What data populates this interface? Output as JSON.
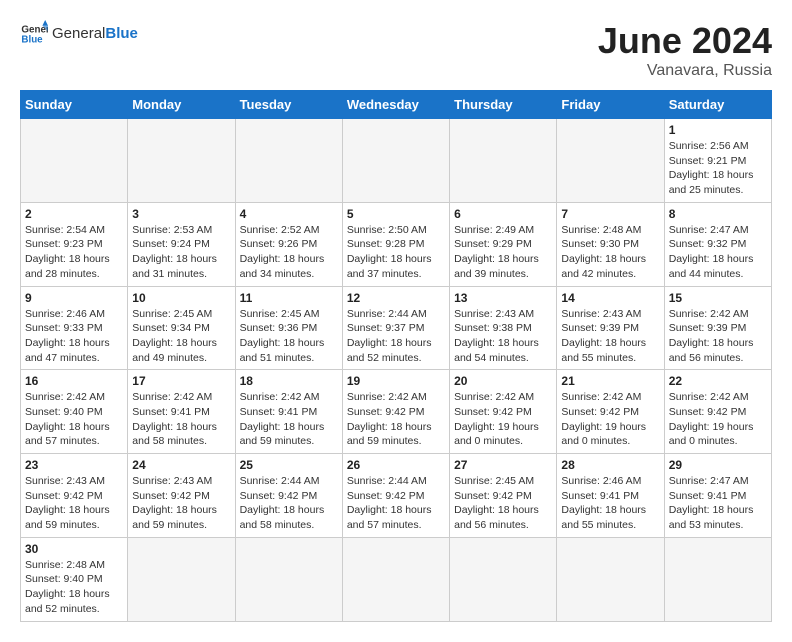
{
  "header": {
    "logo_general": "General",
    "logo_blue": "Blue",
    "month_year": "June 2024",
    "location": "Vanavara, Russia"
  },
  "days_of_week": [
    "Sunday",
    "Monday",
    "Tuesday",
    "Wednesday",
    "Thursday",
    "Friday",
    "Saturday"
  ],
  "weeks": [
    [
      {
        "day": "",
        "info": ""
      },
      {
        "day": "",
        "info": ""
      },
      {
        "day": "",
        "info": ""
      },
      {
        "day": "",
        "info": ""
      },
      {
        "day": "",
        "info": ""
      },
      {
        "day": "",
        "info": ""
      },
      {
        "day": "1",
        "info": "Sunrise: 2:56 AM\nSunset: 9:21 PM\nDaylight: 18 hours\nand 25 minutes."
      }
    ],
    [
      {
        "day": "2",
        "info": "Sunrise: 2:54 AM\nSunset: 9:23 PM\nDaylight: 18 hours\nand 28 minutes."
      },
      {
        "day": "3",
        "info": "Sunrise: 2:53 AM\nSunset: 9:24 PM\nDaylight: 18 hours\nand 31 minutes."
      },
      {
        "day": "4",
        "info": "Sunrise: 2:52 AM\nSunset: 9:26 PM\nDaylight: 18 hours\nand 34 minutes."
      },
      {
        "day": "5",
        "info": "Sunrise: 2:50 AM\nSunset: 9:28 PM\nDaylight: 18 hours\nand 37 minutes."
      },
      {
        "day": "6",
        "info": "Sunrise: 2:49 AM\nSunset: 9:29 PM\nDaylight: 18 hours\nand 39 minutes."
      },
      {
        "day": "7",
        "info": "Sunrise: 2:48 AM\nSunset: 9:30 PM\nDaylight: 18 hours\nand 42 minutes."
      },
      {
        "day": "8",
        "info": "Sunrise: 2:47 AM\nSunset: 9:32 PM\nDaylight: 18 hours\nand 44 minutes."
      }
    ],
    [
      {
        "day": "9",
        "info": "Sunrise: 2:46 AM\nSunset: 9:33 PM\nDaylight: 18 hours\nand 47 minutes."
      },
      {
        "day": "10",
        "info": "Sunrise: 2:45 AM\nSunset: 9:34 PM\nDaylight: 18 hours\nand 49 minutes."
      },
      {
        "day": "11",
        "info": "Sunrise: 2:45 AM\nSunset: 9:36 PM\nDaylight: 18 hours\nand 51 minutes."
      },
      {
        "day": "12",
        "info": "Sunrise: 2:44 AM\nSunset: 9:37 PM\nDaylight: 18 hours\nand 52 minutes."
      },
      {
        "day": "13",
        "info": "Sunrise: 2:43 AM\nSunset: 9:38 PM\nDaylight: 18 hours\nand 54 minutes."
      },
      {
        "day": "14",
        "info": "Sunrise: 2:43 AM\nSunset: 9:39 PM\nDaylight: 18 hours\nand 55 minutes."
      },
      {
        "day": "15",
        "info": "Sunrise: 2:42 AM\nSunset: 9:39 PM\nDaylight: 18 hours\nand 56 minutes."
      }
    ],
    [
      {
        "day": "16",
        "info": "Sunrise: 2:42 AM\nSunset: 9:40 PM\nDaylight: 18 hours\nand 57 minutes."
      },
      {
        "day": "17",
        "info": "Sunrise: 2:42 AM\nSunset: 9:41 PM\nDaylight: 18 hours\nand 58 minutes."
      },
      {
        "day": "18",
        "info": "Sunrise: 2:42 AM\nSunset: 9:41 PM\nDaylight: 18 hours\nand 59 minutes."
      },
      {
        "day": "19",
        "info": "Sunrise: 2:42 AM\nSunset: 9:42 PM\nDaylight: 18 hours\nand 59 minutes."
      },
      {
        "day": "20",
        "info": "Sunrise: 2:42 AM\nSunset: 9:42 PM\nDaylight: 19 hours\nand 0 minutes."
      },
      {
        "day": "21",
        "info": "Sunrise: 2:42 AM\nSunset: 9:42 PM\nDaylight: 19 hours\nand 0 minutes."
      },
      {
        "day": "22",
        "info": "Sunrise: 2:42 AM\nSunset: 9:42 PM\nDaylight: 19 hours\nand 0 minutes."
      }
    ],
    [
      {
        "day": "23",
        "info": "Sunrise: 2:43 AM\nSunset: 9:42 PM\nDaylight: 18 hours\nand 59 minutes."
      },
      {
        "day": "24",
        "info": "Sunrise: 2:43 AM\nSunset: 9:42 PM\nDaylight: 18 hours\nand 59 minutes."
      },
      {
        "day": "25",
        "info": "Sunrise: 2:44 AM\nSunset: 9:42 PM\nDaylight: 18 hours\nand 58 minutes."
      },
      {
        "day": "26",
        "info": "Sunrise: 2:44 AM\nSunset: 9:42 PM\nDaylight: 18 hours\nand 57 minutes."
      },
      {
        "day": "27",
        "info": "Sunrise: 2:45 AM\nSunset: 9:42 PM\nDaylight: 18 hours\nand 56 minutes."
      },
      {
        "day": "28",
        "info": "Sunrise: 2:46 AM\nSunset: 9:41 PM\nDaylight: 18 hours\nand 55 minutes."
      },
      {
        "day": "29",
        "info": "Sunrise: 2:47 AM\nSunset: 9:41 PM\nDaylight: 18 hours\nand 53 minutes."
      }
    ],
    [
      {
        "day": "30",
        "info": "Sunrise: 2:48 AM\nSunset: 9:40 PM\nDaylight: 18 hours\nand 52 minutes."
      },
      {
        "day": "",
        "info": ""
      },
      {
        "day": "",
        "info": ""
      },
      {
        "day": "",
        "info": ""
      },
      {
        "day": "",
        "info": ""
      },
      {
        "day": "",
        "info": ""
      },
      {
        "day": "",
        "info": ""
      }
    ]
  ]
}
